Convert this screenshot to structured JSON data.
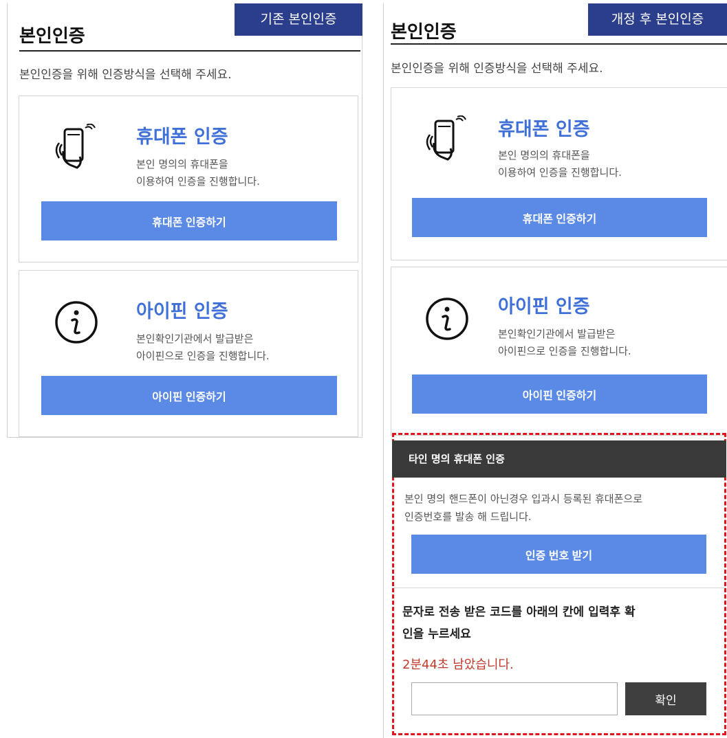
{
  "left": {
    "tag": "기존 본인인증",
    "title": "본인인증",
    "subtitle": "본인인증을 위해 인증방식을 선택해 주세요.",
    "phone": {
      "icon": "phone-vibrate-icon",
      "heading": "휴대폰 인증",
      "desc_line1": "본인 명의의 휴대폰을",
      "desc_line2": "이용하여 인증을 진행합니다.",
      "button": "휴대폰 인증하기"
    },
    "ipin": {
      "icon": "info-circle-icon",
      "heading": "아이핀 인증",
      "desc_line1": "본인확인기관에서 발급받은",
      "desc_line2": "아이핀으로 인증을 진행합니다.",
      "button": "아이핀 인증하기"
    }
  },
  "right": {
    "tag": "개정 후 본인인증",
    "title": "본인인증",
    "subtitle": "본인인증을 위해 인증방식을 선택해 주세요.",
    "phone": {
      "icon": "phone-vibrate-icon",
      "heading": "휴대폰 인증",
      "desc_line1": "본인 명의의 휴대폰을",
      "desc_line2": "이용하여 인증을 진행합니다.",
      "button": "휴대폰 인증하기"
    },
    "ipin": {
      "icon": "info-circle-icon",
      "heading": "아이핀 인증",
      "desc_line1": "본인확인기관에서 발급받은",
      "desc_line2": "아이핀으로 인증을 진행합니다.",
      "button": "아이핀 인증하기"
    },
    "other": {
      "bar_title": "타인 명의 휴대폰 인증",
      "desc_line1": "본인 명의 핸드폰이 아닌경우 입과시 등록된 휴대폰으로",
      "desc_line2": "인증번호를 발송 해 드립니다.",
      "button": "인증 번호 받기",
      "help_line1": "문자로 전송 받은 코드를 아래의 칸에 입력후 확",
      "help_line2": "인을 누르세요",
      "timer": "2분44초 남았습니다.",
      "input_value": "",
      "confirm": "확인"
    }
  },
  "colors": {
    "tag_bg": "#2b3e8c",
    "accent_blue": "#3f6fd8",
    "button_blue": "#5a8ae6",
    "dark_bar": "#3a3a3a",
    "highlight_red": "#e0141c",
    "timer_red": "#c0392b"
  }
}
